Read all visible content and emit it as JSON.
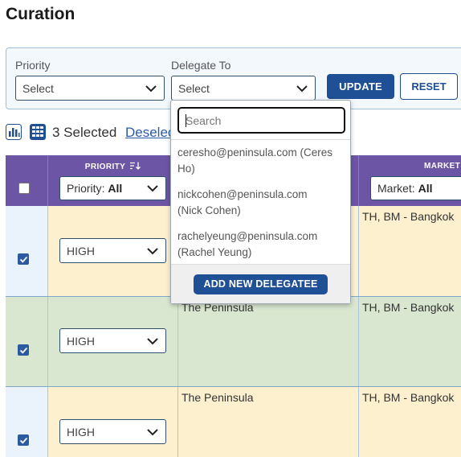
{
  "page": {
    "title": "Curation"
  },
  "filters": {
    "priority_label": "Priority",
    "priority_value": "Select",
    "delegate_label": "Delegate To",
    "delegate_value": "Select",
    "update_label": "UPDATE",
    "reset_label": "RESET"
  },
  "toolbar": {
    "selected_text": "3 Selected",
    "deselect_label": "Deselec"
  },
  "grid": {
    "columns": [
      {
        "title": "PRIORITY",
        "filter_key": "Priority",
        "filter_value": "All"
      },
      {
        "title": "",
        "filter_key": "",
        "filter_value": ""
      },
      {
        "title": "MARKET",
        "filter_key": "Market",
        "filter_value": "All"
      }
    ],
    "rows": [
      {
        "checked": true,
        "priority": "HIGH",
        "hotel": "",
        "market": "TH, BM - Bangkok",
        "color": "#fdf0cf"
      },
      {
        "checked": true,
        "priority": "HIGH",
        "hotel": "The Peninsula",
        "market": "TH, BM - Bangkok",
        "color": "#d9e7d0"
      },
      {
        "checked": true,
        "priority": "HIGH",
        "hotel": "The Peninsula",
        "market": "TH, BM - Bangkok",
        "color": "#fdf0cf"
      }
    ]
  },
  "delegate_dropdown": {
    "search_placeholder": "Search",
    "options": [
      {
        "line1": "ceresho@peninsula.com (Ceres",
        "line2": "Ho)"
      },
      {
        "line1": "nickcohen@peninsula.com",
        "line2": "(Nick Cohen)"
      },
      {
        "line1": "rachelyeung@peninsula.com",
        "line2": "(Rachel Yeung)"
      }
    ],
    "add_label": "ADD NEW DELEGATEE"
  },
  "colors": {
    "header_purple": "#6d55a6",
    "primary_blue": "#1f4f94",
    "row_yellow": "#fdf0cf",
    "row_green": "#d9e7d0"
  }
}
